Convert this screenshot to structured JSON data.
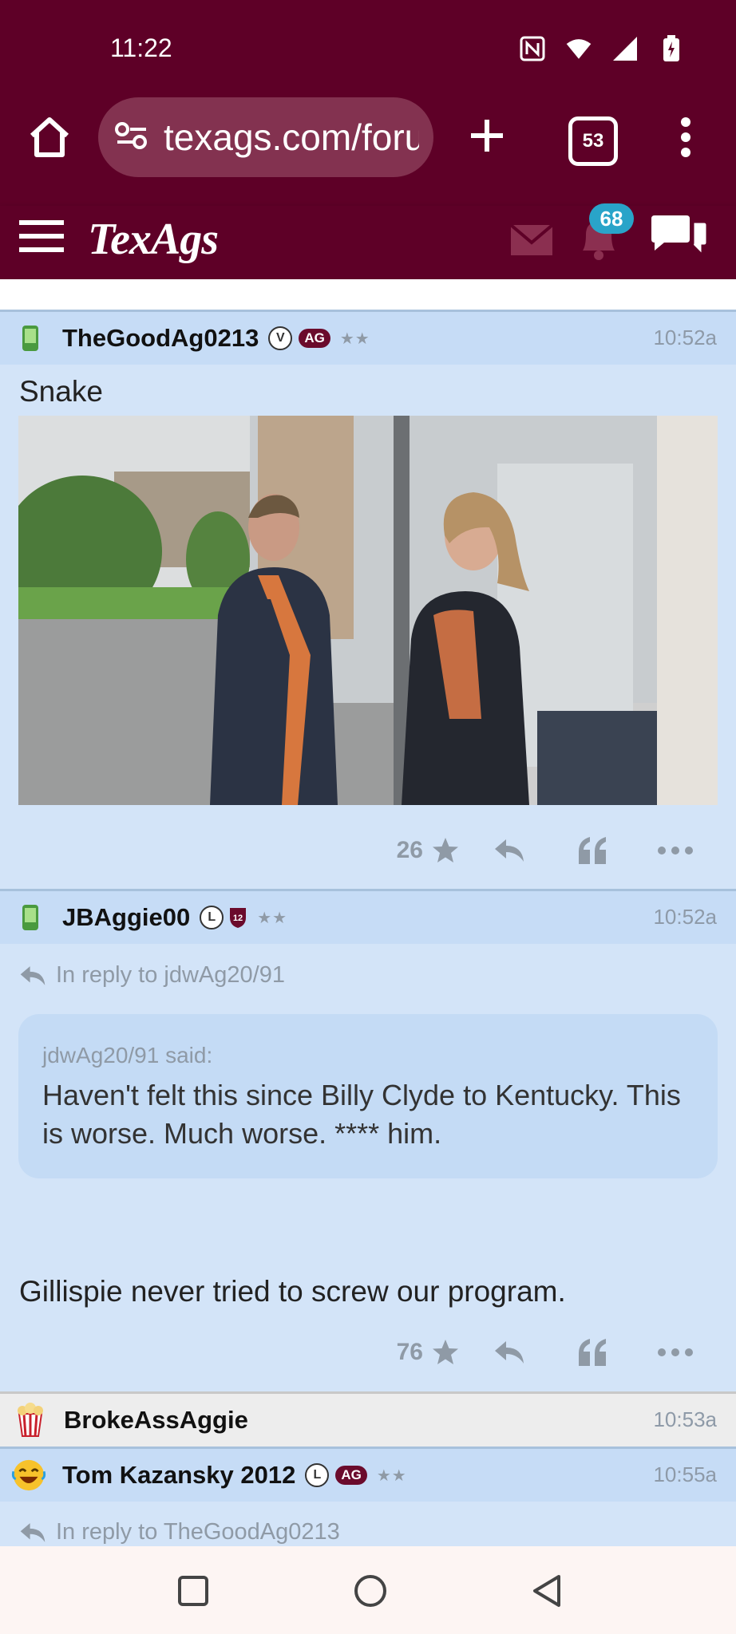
{
  "status_bar": {
    "time": "11:22"
  },
  "browser": {
    "url": "texags.com/forums",
    "tab_count": "53"
  },
  "site": {
    "logo_text": "TexAgs",
    "notification_count": "68"
  },
  "posts": [
    {
      "username": "TheGoodAg0213",
      "badges": [
        "V",
        "AG"
      ],
      "stars": "★★",
      "time": "10:52a",
      "text": "Snake",
      "image_alt": "Man in suit with orange tie and woman in orange blouse talking in a building lobby",
      "star_count": "26"
    },
    {
      "username": "JBAggie00",
      "badges": [
        "L",
        "12"
      ],
      "stars": "★★",
      "time": "10:52a",
      "reply_to": "In reply to jdwAg20/91",
      "quote_said": "jdwAg20/91 said:",
      "quote_text": "Haven't felt this since Billy Clyde to Kentucky. This is worse. Much worse. **** him.",
      "text": "Gillispie never tried to screw our program.",
      "star_count": "76"
    },
    {
      "username": "BrokeAssAggie",
      "time": "10:53a"
    },
    {
      "username": "Tom Kazansky 2012",
      "badges": [
        "L",
        "AG"
      ],
      "stars": "★★",
      "time": "10:55a",
      "reply_to": "In reply to TheGoodAg0213"
    }
  ],
  "colors": {
    "maroon": "#5e0027",
    "post_bg": "#d3e4f8",
    "header_bg": "#c6dcf6",
    "muted": "#8f9aa6"
  }
}
